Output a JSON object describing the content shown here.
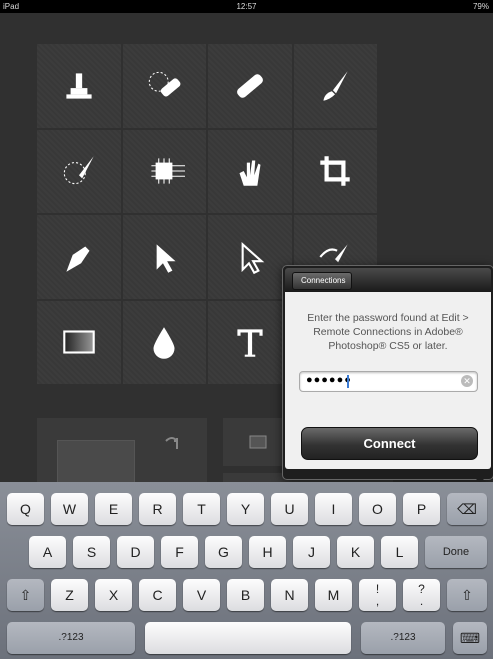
{
  "status_bar": {
    "device": "iPad",
    "time": "12:57",
    "battery": "79%"
  },
  "tools": [
    {
      "icon": "stamp-icon"
    },
    {
      "icon": "healing-patch-icon"
    },
    {
      "icon": "bandage-icon"
    },
    {
      "icon": "brush-icon"
    },
    {
      "icon": "history-brush-icon"
    },
    {
      "icon": "chip-icon"
    },
    {
      "icon": "smudge-hand-icon"
    },
    {
      "icon": "crop-icon"
    },
    {
      "icon": "pen-icon"
    },
    {
      "icon": "arrow-icon"
    },
    {
      "icon": "hollow-arrow-icon"
    },
    {
      "icon": "brush-swap-icon"
    },
    {
      "icon": "gradient-icon"
    },
    {
      "icon": "drop-icon"
    },
    {
      "icon": "type-icon"
    },
    {
      "icon": "empty"
    }
  ],
  "popover": {
    "back_label": "Connections",
    "message": "Enter the password found at Edit > Remote Connections in Adobe® Photoshop® CS5 or later.",
    "password_value": "●●●●●●",
    "connect_label": "Connect"
  },
  "keyboard": {
    "row1": [
      "Q",
      "W",
      "E",
      "R",
      "T",
      "Y",
      "U",
      "I",
      "O",
      "P",
      "⌫"
    ],
    "row2": [
      "A",
      "S",
      "D",
      "F",
      "G",
      "H",
      "J",
      "K",
      "L",
      "Done"
    ],
    "row3": [
      "⇧",
      "Z",
      "X",
      "C",
      "V",
      "B",
      "N",
      "M",
      "!",
      ",",
      "?",
      ".",
      "⇧"
    ],
    "row4_left": ".?123",
    "row4_right": ".?123",
    "keyboard_icon": "⌨"
  }
}
